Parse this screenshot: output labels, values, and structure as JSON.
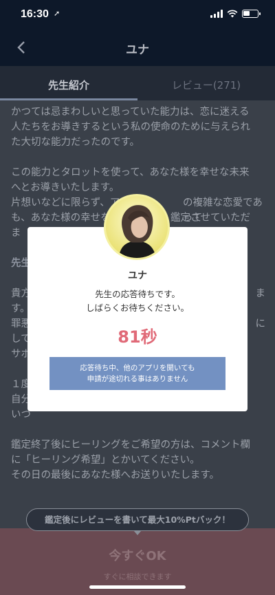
{
  "status_bar": {
    "time": "16:30",
    "location_icon": "location-arrow-icon",
    "battery_level_percent": 45
  },
  "nav": {
    "back_icon": "chevron-left-icon",
    "title": "ユナ"
  },
  "tabs": [
    {
      "label": "先生紹介",
      "active": true
    },
    {
      "label": "レビュー(271)",
      "active": false
    }
  ],
  "content": {
    "para1": [
      "かつては忌まわしいと思っていた能力は、恋に迷える",
      "人たちをお導きするという私の使命のために与えられ",
      "た大切な能力だったのです。"
    ],
    "para2": [
      "この能力とタロットを使って、あなた様を幸せな未来",
      "へとお導きいたします。",
      "片想いなどに限らず、ア",
      "も、あなた様の幸せを",
      "鑑定させていただ"
    ],
    "heading_fragment": "先生",
    "para3_left": [
      "貴方",
      "す。",
      "罪悪",
      "して",
      "サポ"
    ],
    "para3_right": [
      "ま",
      "に"
    ],
    "para4": [
      "１度",
      "自分",
      "いつ"
    ],
    "para5": [
      "鑑定終了後にヒーリングをご希望の方は、コメント欄",
      "に「ヒーリング希望」とかいてください。",
      "その日の最後にあなた様へお送りいたします。"
    ]
  },
  "modal": {
    "name": "ユナ",
    "message_line1": "先生の応答待ちです。",
    "message_line2": "しばらくお待ちください。",
    "countdown": "81秒",
    "note_line1": "応答待ち中、他のアプリを開いても",
    "note_line2": "申請が途切れる事はありません"
  },
  "bottom": {
    "review_banner": "鑑定後にレビューを書いて最大10%Ptバック！",
    "cta_label": "今すぐOK",
    "cta_sub": "すぐに相談できます"
  },
  "colors": {
    "accent_countdown": "#e06a78",
    "note_background": "#7391c2",
    "cta_background": "#6a4a52",
    "nav_background": "#0d1829"
  }
}
